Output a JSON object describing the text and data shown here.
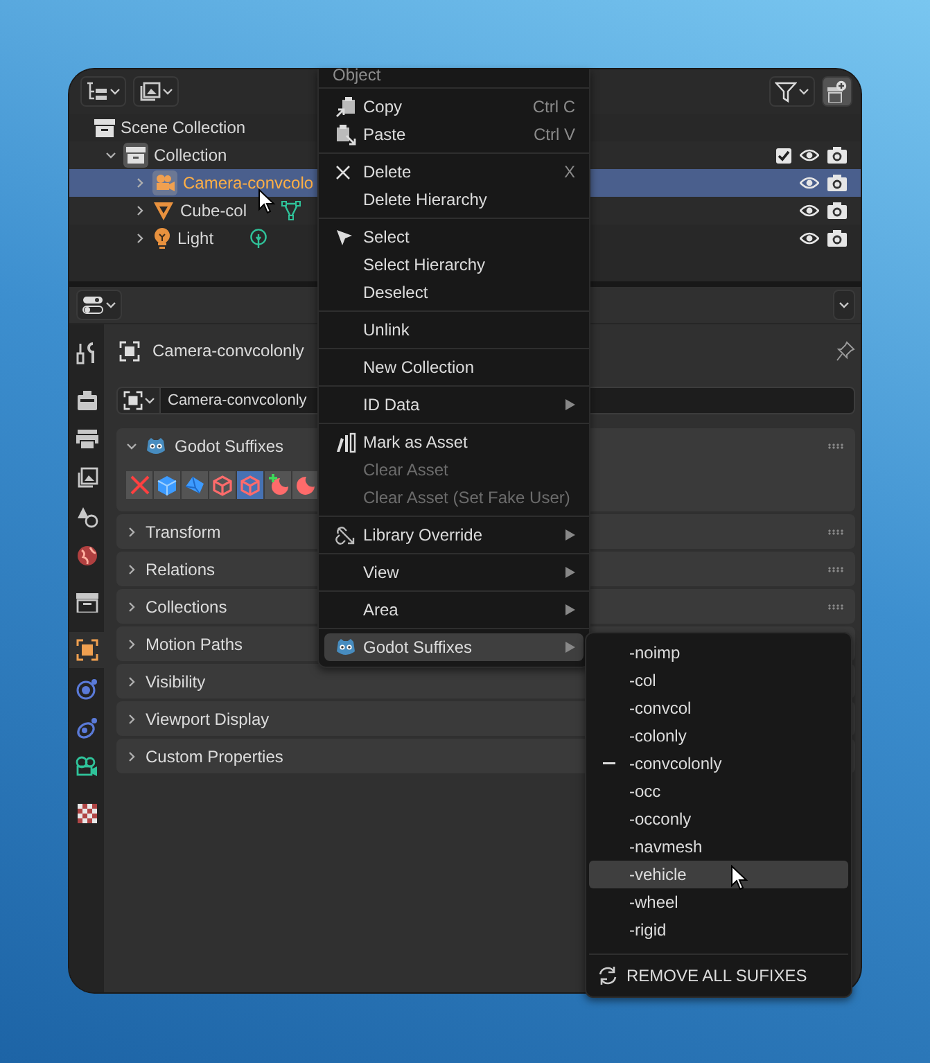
{
  "outliner": {
    "tree": [
      {
        "label": "Scene Collection",
        "kind": "scene-collection",
        "selected": false,
        "children": [
          {
            "label": "Collection",
            "kind": "collection",
            "selected": false,
            "expanded": true,
            "checked": true,
            "children": [
              {
                "label": "Camera-convcolo",
                "kind": "camera",
                "selected": true,
                "expanded": false
              },
              {
                "label": "Cube-col",
                "kind": "mesh",
                "selected": false,
                "expanded": false
              },
              {
                "label": "Light",
                "kind": "light",
                "selected": false,
                "expanded": false
              }
            ]
          }
        ]
      }
    ]
  },
  "properties": {
    "object_name": "Camera-convcolonly",
    "data_value": "Camera-convcolonly",
    "tab_groups": [
      [
        {
          "kind": "tool",
          "selected": false
        }
      ],
      [
        {
          "kind": "render",
          "selected": false
        },
        {
          "kind": "output",
          "selected": false
        },
        {
          "kind": "view-layer",
          "selected": false
        },
        {
          "kind": "scene",
          "selected": false
        },
        {
          "kind": "world",
          "selected": false
        }
      ],
      [
        {
          "kind": "collection",
          "selected": false
        }
      ],
      [
        {
          "kind": "object",
          "selected": true
        },
        {
          "kind": "physics",
          "selected": false
        },
        {
          "kind": "constraints",
          "selected": false
        },
        {
          "kind": "data",
          "selected": false
        }
      ],
      [
        {
          "kind": "texture",
          "selected": false
        }
      ]
    ],
    "panels": [
      {
        "label": "Godot Suffixes",
        "expanded": true,
        "buttons": [
          {
            "kind": "remove",
            "selected": false
          },
          {
            "kind": "cube",
            "selected": false
          },
          {
            "kind": "wedge",
            "selected": false
          },
          {
            "kind": "cube-outline",
            "selected": false
          },
          {
            "kind": "cube-outline",
            "selected": true
          },
          {
            "kind": "moon-plus",
            "selected": false
          },
          {
            "kind": "moon",
            "selected": false
          }
        ]
      },
      {
        "label": "Transform",
        "expanded": false
      },
      {
        "label": "Relations",
        "expanded": false
      },
      {
        "label": "Collections",
        "expanded": false
      },
      {
        "label": "Motion Paths",
        "expanded": false
      },
      {
        "label": "Visibility",
        "expanded": false
      },
      {
        "label": "Viewport Display",
        "expanded": false
      },
      {
        "label": "Custom Properties",
        "expanded": false
      }
    ]
  },
  "context_menu": {
    "title": "Object",
    "sections": [
      [
        {
          "label": "Copy",
          "shortcut": "Ctrl C",
          "kind": "copy",
          "disabled": false,
          "submenu": false,
          "selected": false
        },
        {
          "label": "Paste",
          "shortcut": "Ctrl V",
          "kind": "paste",
          "disabled": false,
          "submenu": false,
          "selected": false
        }
      ],
      [
        {
          "label": "Delete",
          "shortcut": "X",
          "kind": "delete",
          "disabled": false,
          "submenu": false,
          "selected": false
        },
        {
          "label": "Delete Hierarchy",
          "disabled": false,
          "submenu": false,
          "selected": false
        }
      ],
      [
        {
          "label": "Select",
          "kind": "select",
          "disabled": false,
          "submenu": false,
          "selected": false
        },
        {
          "label": "Select Hierarchy",
          "disabled": false,
          "submenu": false,
          "selected": false
        },
        {
          "label": "Deselect",
          "disabled": false,
          "submenu": false,
          "selected": false
        }
      ],
      [
        {
          "label": "Unlink",
          "disabled": false,
          "submenu": false,
          "selected": false
        }
      ],
      [
        {
          "label": "New Collection",
          "disabled": false,
          "submenu": false,
          "selected": false
        }
      ],
      [
        {
          "label": "ID Data",
          "disabled": false,
          "submenu": true,
          "selected": false
        }
      ],
      [
        {
          "label": "Mark as Asset",
          "kind": "asset",
          "disabled": false,
          "submenu": false,
          "selected": false
        },
        {
          "label": "Clear Asset",
          "disabled": true,
          "submenu": false,
          "selected": false
        },
        {
          "label": "Clear Asset (Set Fake User)",
          "disabled": true,
          "submenu": false,
          "selected": false
        }
      ],
      [
        {
          "label": "Library Override",
          "kind": "override",
          "disabled": false,
          "submenu": true,
          "selected": false
        }
      ],
      [
        {
          "label": "View",
          "disabled": false,
          "submenu": true,
          "selected": false
        }
      ],
      [
        {
          "label": "Area",
          "disabled": false,
          "submenu": true,
          "selected": false
        }
      ],
      [
        {
          "label": "Godot Suffixes",
          "kind": "godot",
          "disabled": false,
          "submenu": true,
          "selected": true
        }
      ]
    ]
  },
  "submenu": {
    "items": [
      {
        "label": "-noimp",
        "checked": false,
        "selected": false
      },
      {
        "label": "-col",
        "checked": false,
        "selected": false
      },
      {
        "label": "-convcol",
        "checked": false,
        "selected": false
      },
      {
        "label": "-colonly",
        "checked": false,
        "selected": false
      },
      {
        "label": "-convcolonly",
        "checked": true,
        "selected": false
      },
      {
        "label": "-occ",
        "checked": false,
        "selected": false
      },
      {
        "label": "-occonly",
        "checked": false,
        "selected": false
      },
      {
        "label": "-navmesh",
        "checked": false,
        "selected": false
      },
      {
        "label": "-vehicle",
        "checked": false,
        "selected": true
      },
      {
        "label": "-wheel",
        "checked": false,
        "selected": false
      },
      {
        "label": "-rigid",
        "checked": false,
        "selected": false
      }
    ],
    "footer": "REMOVE ALL SUFIXES"
  }
}
